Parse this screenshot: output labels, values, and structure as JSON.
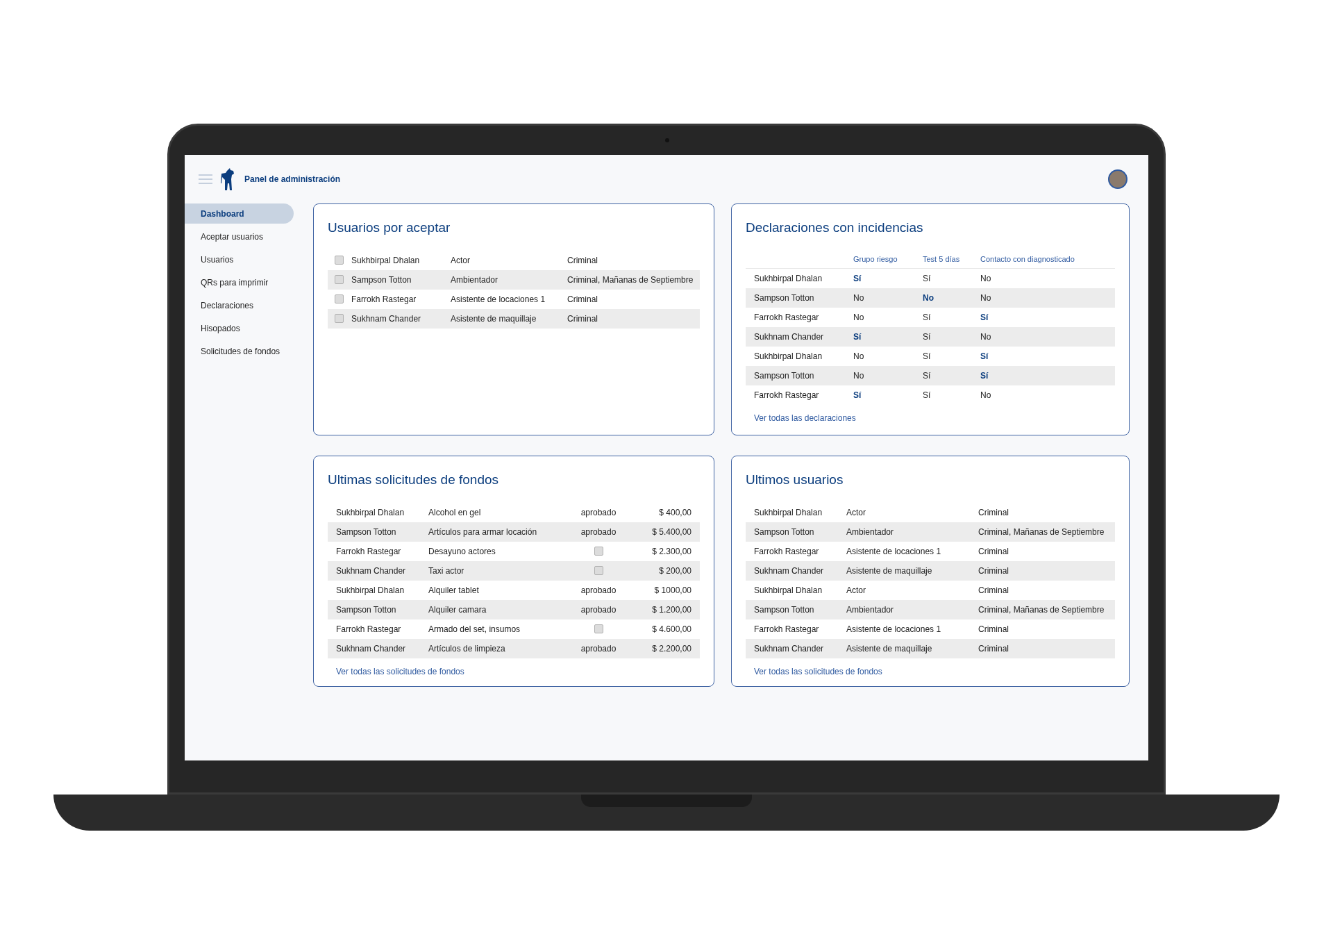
{
  "header": {
    "title": "Panel de administración"
  },
  "sidebar": {
    "items": [
      {
        "label": "Dashboard",
        "selected": true
      },
      {
        "label": "Aceptar usuarios",
        "selected": false
      },
      {
        "label": "Usuarios",
        "selected": false
      },
      {
        "label": "QRs para imprimir",
        "selected": false
      },
      {
        "label": "Declaraciones",
        "selected": false
      },
      {
        "label": "Hisopados",
        "selected": false
      },
      {
        "label": "Solicitudes de fondos",
        "selected": false
      }
    ]
  },
  "pending_users": {
    "title": "Usuarios por aceptar",
    "rows": [
      {
        "checked": false,
        "name": "Sukhbirpal Dhalan",
        "role": "Actor",
        "projects": "Criminal"
      },
      {
        "checked": false,
        "name": "Sampson Totton",
        "role": "Ambientador",
        "projects": "Criminal, Mañanas de Septiembre"
      },
      {
        "checked": false,
        "name": "Farrokh Rastegar",
        "role": "Asistente de locaciones 1",
        "projects": "Criminal"
      },
      {
        "checked": false,
        "name": "Sukhnam Chander",
        "role": "Asistente de maquillaje",
        "projects": "Criminal"
      }
    ]
  },
  "declarations": {
    "title": "Declaraciones con incidencias",
    "columns": [
      "Grupo riesgo",
      "Test 5 días",
      "Contacto con diagnosticado"
    ],
    "rows": [
      {
        "name": "Sukhbirpal Dhalan",
        "cells": [
          {
            "text": "Sí",
            "flagged": true
          },
          {
            "text": "Sí",
            "flagged": false
          },
          {
            "text": "No",
            "flagged": false
          }
        ]
      },
      {
        "name": "Sampson Totton",
        "cells": [
          {
            "text": "No",
            "flagged": false
          },
          {
            "text": "No",
            "flagged": true
          },
          {
            "text": "No",
            "flagged": false
          }
        ]
      },
      {
        "name": "Farrokh Rastegar",
        "cells": [
          {
            "text": "No",
            "flagged": false
          },
          {
            "text": "Sí",
            "flagged": false
          },
          {
            "text": "Sí",
            "flagged": true
          }
        ]
      },
      {
        "name": "Sukhnam Chander",
        "cells": [
          {
            "text": "Sí",
            "flagged": true
          },
          {
            "text": "Sí",
            "flagged": false
          },
          {
            "text": "No",
            "flagged": false
          }
        ]
      },
      {
        "name": "Sukhbirpal Dhalan",
        "cells": [
          {
            "text": "No",
            "flagged": false
          },
          {
            "text": "Sí",
            "flagged": false
          },
          {
            "text": "Sí",
            "flagged": true
          }
        ]
      },
      {
        "name": "Sampson Totton",
        "cells": [
          {
            "text": "No",
            "flagged": false
          },
          {
            "text": "Sí",
            "flagged": false
          },
          {
            "text": "Sí",
            "flagged": true
          }
        ]
      },
      {
        "name": "Farrokh Rastegar",
        "cells": [
          {
            "text": "Sí",
            "flagged": true
          },
          {
            "text": "Sí",
            "flagged": false
          },
          {
            "text": "No",
            "flagged": false
          }
        ]
      }
    ],
    "link": "Ver todas las declaraciones"
  },
  "funds": {
    "title": "Ultimas solicitudes de fondos",
    "rows": [
      {
        "name": "Sukhbirpal Dhalan",
        "item": "Alcohol en gel",
        "status": {
          "kind": "text",
          "text": "aprobado"
        },
        "amount": "$ 400,00"
      },
      {
        "name": "Sampson Totton",
        "item": "Artículos para armar locación",
        "status": {
          "kind": "text",
          "text": "aprobado"
        },
        "amount": "$ 5.400,00"
      },
      {
        "name": "Farrokh Rastegar",
        "item": "Desayuno actores",
        "status": {
          "kind": "checkbox",
          "checked": false
        },
        "amount": "$ 2.300,00"
      },
      {
        "name": "Sukhnam Chander",
        "item": "Taxi actor",
        "status": {
          "kind": "checkbox",
          "checked": false
        },
        "amount": "$ 200,00"
      },
      {
        "name": "Sukhbirpal Dhalan",
        "item": "Alquiler tablet",
        "status": {
          "kind": "text",
          "text": "aprobado"
        },
        "amount": "$ 1000,00"
      },
      {
        "name": "Sampson Totton",
        "item": "Alquiler camara",
        "status": {
          "kind": "text",
          "text": "aprobado"
        },
        "amount": "$ 1.200,00"
      },
      {
        "name": "Farrokh Rastegar",
        "item": "Armado del set, insumos",
        "status": {
          "kind": "checkbox",
          "checked": false
        },
        "amount": "$ 4.600,00"
      },
      {
        "name": "Sukhnam Chander",
        "item": "Artículos de limpieza",
        "status": {
          "kind": "text",
          "text": "aprobado"
        },
        "amount": "$ 2.200,00"
      }
    ],
    "link": "Ver todas las solicitudes de fondos"
  },
  "latest_users": {
    "title": "Ultimos usuarios",
    "rows": [
      {
        "name": "Sukhbirpal Dhalan",
        "role": "Actor",
        "projects": "Criminal"
      },
      {
        "name": "Sampson Totton",
        "role": "Ambientador",
        "projects": "Criminal, Mañanas de Septiembre"
      },
      {
        "name": "Farrokh Rastegar",
        "role": "Asistente de locaciones 1",
        "projects": "Criminal"
      },
      {
        "name": "Sukhnam Chander",
        "role": "Asistente de maquillaje",
        "projects": "Criminal"
      },
      {
        "name": "Sukhbirpal Dhalan",
        "role": "Actor",
        "projects": "Criminal"
      },
      {
        "name": "Sampson Totton",
        "role": "Ambientador",
        "projects": "Criminal, Mañanas de Septiembre"
      },
      {
        "name": "Farrokh Rastegar",
        "role": "Asistente de locaciones 1",
        "projects": "Criminal"
      },
      {
        "name": "Sukhnam Chander",
        "role": "Asistente de maquillaje",
        "projects": "Criminal"
      }
    ],
    "link": "Ver todas las solicitudes de fondos"
  }
}
